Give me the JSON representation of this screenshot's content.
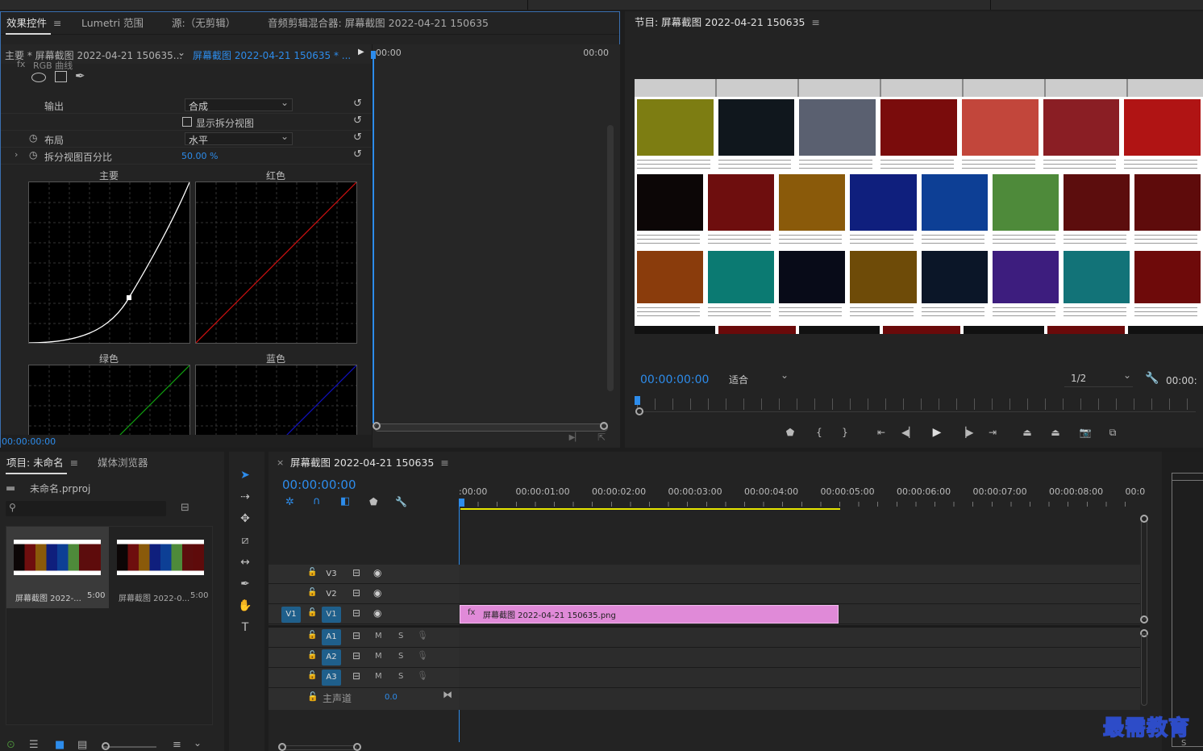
{
  "effects_panel": {
    "tabs": [
      {
        "label": "效果控件"
      },
      {
        "label": "Lumetri 范围"
      },
      {
        "label": "源:（无剪辑）"
      },
      {
        "label": "音频剪辑混合器: 屏幕截图 2022-04-21 150635"
      }
    ],
    "master_clip": "主要 * 屏幕截图 2022-04-21 150635...",
    "sequence_clip": "屏幕截图 2022-04-21 150635 * ...",
    "tc_left": "00:00",
    "tc_right": "00:00",
    "section_header": "RGB 曲线",
    "rows": {
      "output_label": "输出",
      "output_value": "合成",
      "split_label": "显示拆分视图",
      "layout_label": "布局",
      "layout_value": "水平",
      "split_pct_label": "拆分视图百分比",
      "split_pct_value": "50.00 %"
    },
    "curves": {
      "master": "主要",
      "red": "红色",
      "green": "绿色",
      "blue": "蓝色"
    },
    "footer_tc": "00:00:00:00"
  },
  "program_panel": {
    "title": "节目: 屏幕截图 2022-04-21 150635",
    "timecode": "00:00:00:00",
    "fit": "适合",
    "resolution": "1/2",
    "right_tc": "00:00:"
  },
  "project_panel": {
    "tabs": [
      {
        "label": "项目: 未命名"
      },
      {
        "label": "媒体浏览器"
      }
    ],
    "project_file": "未命名.prproj",
    "items": [
      {
        "name": "屏幕截图 2022-...",
        "duration": "5:00"
      },
      {
        "name": "屏幕截图 2022-0...",
        "duration": "5:00"
      }
    ]
  },
  "timeline_panel": {
    "title": "屏幕截图 2022-04-21 150635",
    "timecode": "00:00:00:00",
    "ruler": [
      ":00:00",
      "00:00:01:00",
      "00:00:02:00",
      "00:00:03:00",
      "00:00:04:00",
      "00:00:05:00",
      "00:00:06:00",
      "00:00:07:00",
      "00:00:08:00",
      "00:0"
    ],
    "video_tracks": [
      "V3",
      "V2",
      "V1"
    ],
    "audio_tracks": [
      "A1",
      "A2",
      "A3"
    ],
    "source_patch": "V1",
    "mute": "M",
    "solo": "S",
    "master_label": "主声道",
    "master_value": "0.0",
    "clip_name": "屏幕截图 2022-04-21 150635.png"
  },
  "colors": {
    "accent": "#2d8ceb",
    "clip": "#e08ad8",
    "work_area": "#e6e600",
    "track_on": "#1f5f8b"
  },
  "watermark": "最需教育",
  "preview_tiles": [
    {
      "c": "#7d7d12"
    },
    {
      "c": "#10171d"
    },
    {
      "c": "#5a6070"
    },
    {
      "c": "#7a0c0c"
    },
    {
      "c": "#c2463b"
    },
    {
      "c": "#8a1e24"
    },
    {
      "c": "#b01414"
    },
    {
      "c": "#0c0606"
    },
    {
      "c": "#6e0e0e"
    },
    {
      "c": "#8a5a0a"
    },
    {
      "c": "#0f1f7d"
    },
    {
      "c": "#0d3f95"
    },
    {
      "c": "#4e8a3a"
    },
    {
      "c": "#5c0d0d"
    },
    {
      "c": "#5e0b0b"
    },
    {
      "c": "#8a3c0c"
    },
    {
      "c": "#0b7a72"
    },
    {
      "c": "#080b18"
    },
    {
      "c": "#6e4b08"
    },
    {
      "c": "#0b1628"
    },
    {
      "c": "#3d1d7e"
    },
    {
      "c": "#127378"
    },
    {
      "c": "#6e0a0a"
    }
  ]
}
